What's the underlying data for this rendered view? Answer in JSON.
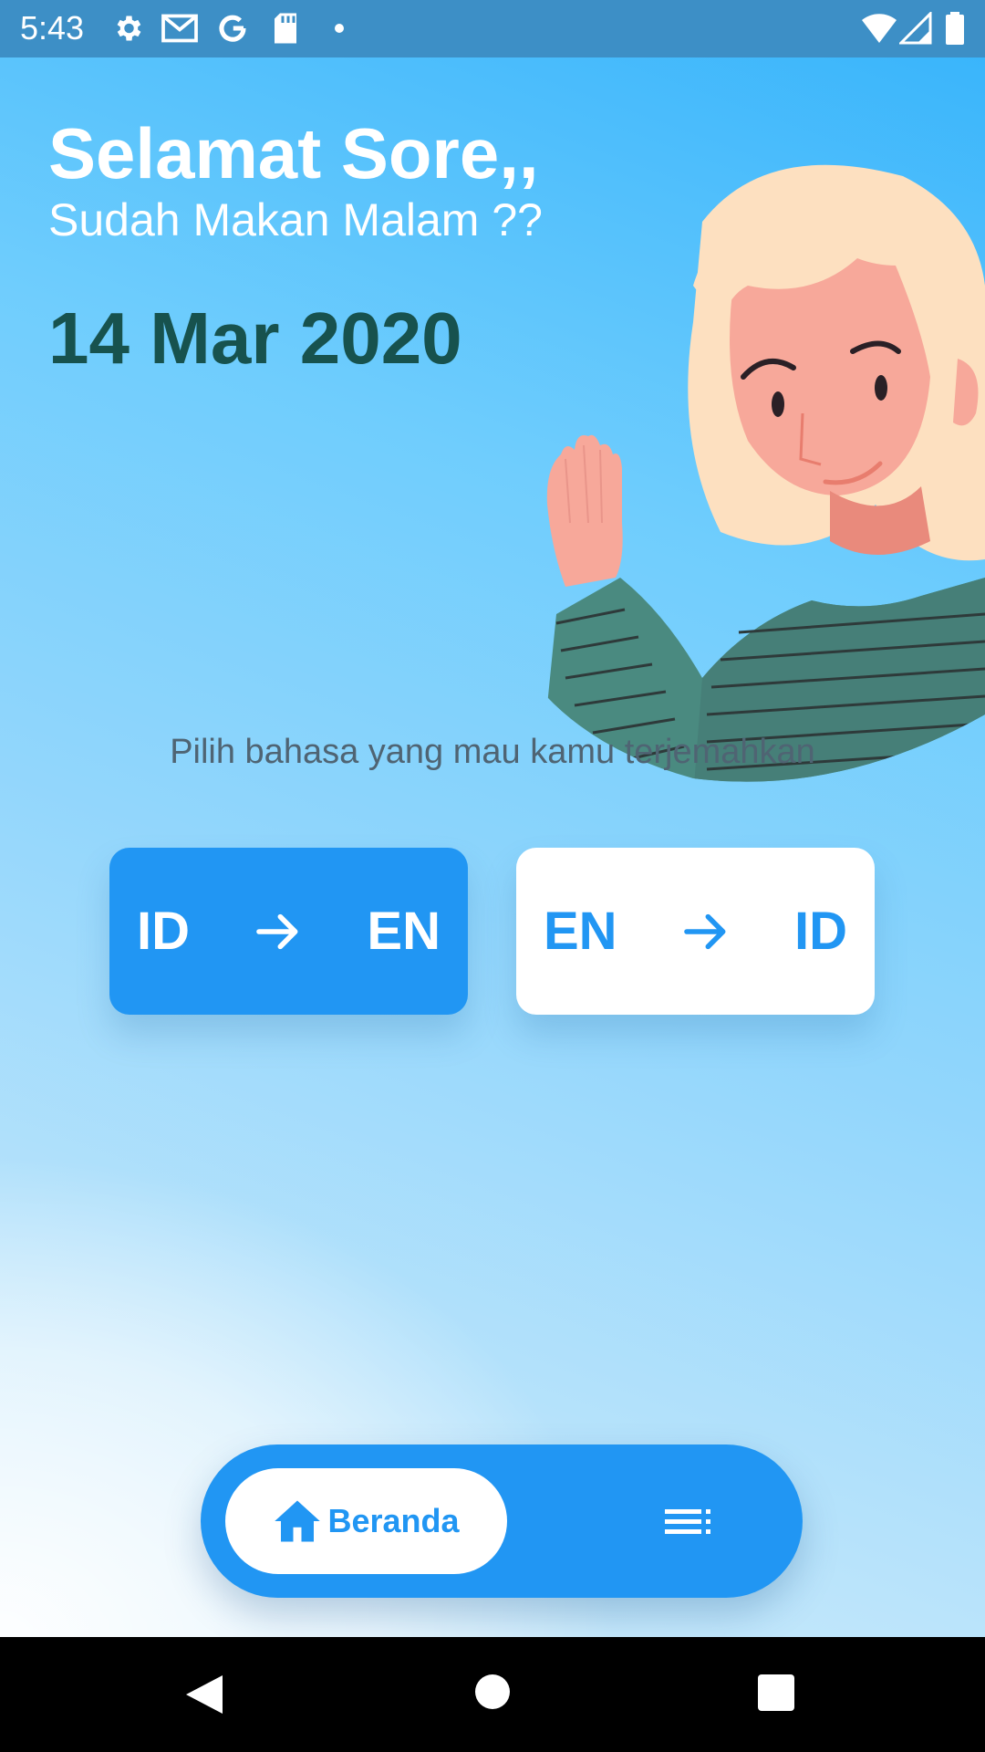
{
  "status_bar": {
    "time": "5:43",
    "icons": [
      "gear-icon",
      "gmail-icon",
      "google-icon",
      "sd-card-icon",
      "dot-icon",
      "wifi-icon",
      "signal-icon",
      "battery-icon"
    ]
  },
  "header": {
    "greeting": "Selamat Sore,,",
    "subgreeting": "Sudah Makan Malam ??",
    "date": "14 Mar 2020"
  },
  "main": {
    "prompt": "Pilih bahasa yang mau kamu terjemahkan",
    "buttons": [
      {
        "from": "ID",
        "to": "EN",
        "icon": "arrow-right-icon",
        "style": "filled"
      },
      {
        "from": "EN",
        "to": "ID",
        "icon": "arrow-right-icon",
        "style": "outline-white"
      }
    ]
  },
  "bottom_nav": {
    "home_label": "Beranda",
    "home_icon": "home-icon",
    "list_icon": "playlist-icon"
  },
  "system_nav": [
    "back-icon",
    "home-circle-icon",
    "recents-icon"
  ],
  "colors": {
    "accent": "#2196f3",
    "date_text": "#17524e",
    "status_bar": "#3d8fc6",
    "sweater": "#4a8a80",
    "hair": "#fde0c0",
    "skin": "#f7a89a"
  }
}
